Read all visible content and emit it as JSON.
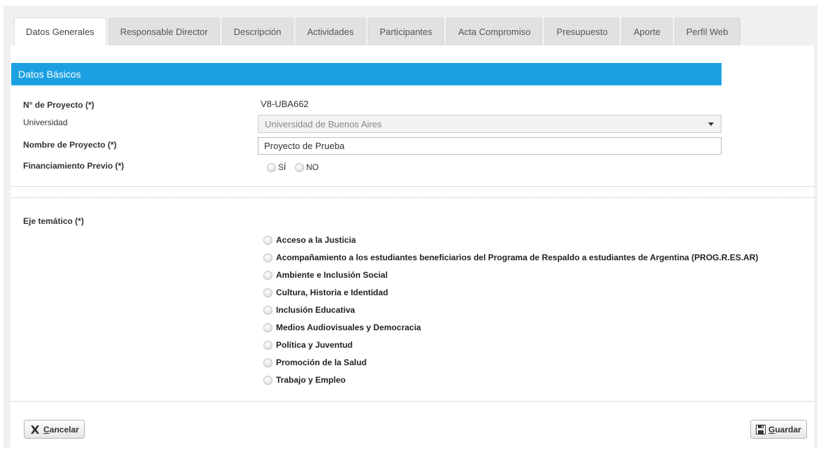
{
  "tabs": [
    {
      "label": "Datos Generales",
      "active": true
    },
    {
      "label": "Responsable Director"
    },
    {
      "label": "Descripción"
    },
    {
      "label": "Actividades"
    },
    {
      "label": "Participantes"
    },
    {
      "label": "Acta Compromiso"
    },
    {
      "label": "Presupuesto"
    },
    {
      "label": "Aporte"
    },
    {
      "label": "Perfil Web"
    }
  ],
  "section": {
    "title": "Datos Básicos",
    "color": "#1ba1e2"
  },
  "fields": {
    "project_number_label": "N° de Proyecto (*)",
    "project_number_value": "V8-UBA662",
    "university_label": "Universidad",
    "university_value": "Universidad de Buenos Aires",
    "project_name_label": "Nombre de Proyecto (*)",
    "project_name_value": "Proyecto de Prueba",
    "prior_funding_label": "Financiamiento Previo (*)",
    "prior_funding_yes": "SÍ",
    "prior_funding_no": "NO"
  },
  "thematic": {
    "label": "Eje temático (*)",
    "options": [
      "Acceso a la Justicia",
      "Acompañamiento a los estudiantes beneficiarios del Programa de Respaldo a estudiantes de Argentina (PROG.R.ES.AR)",
      "Ambiente e Inclusión Social",
      "Cultura, Historia e Identidad",
      "Inclusión Educativa",
      "Medios Audiovisuales y Democracia",
      "Política y Juventud",
      "Promoción de la Salud",
      "Trabajo y Empleo"
    ]
  },
  "buttons": {
    "cancel": "Cancelar",
    "save": "Guardar"
  },
  "icons": {
    "cancel": "close-x-icon",
    "save": "floppy-disk-icon"
  }
}
